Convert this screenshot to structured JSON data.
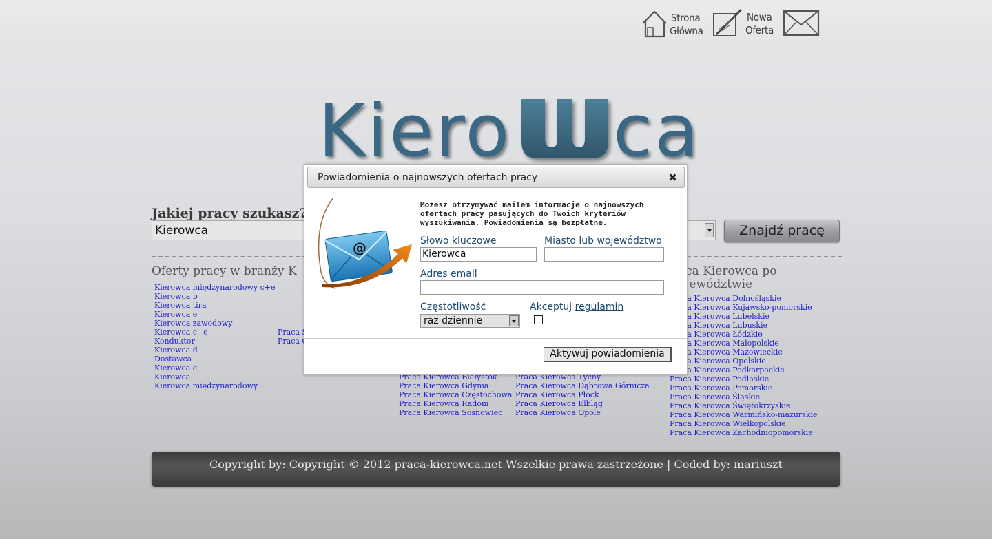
{
  "nav": {
    "home_line1": "Strona",
    "home_line2": "Główna",
    "new_offer_line1": "Nowa",
    "new_offer_line2": "Oferta"
  },
  "logo": {
    "text_left": "Kiero",
    "text_right": "ca"
  },
  "search": {
    "label": "Jakiej pracy szukasz?",
    "keyword_value": "Kierowca",
    "button_label": "Znajdź pracę"
  },
  "sections": {
    "industry_title": "Oferty pracy w branży K",
    "region_title_line1": "aca Kierowca po",
    "region_title_line2": "ojewództwie"
  },
  "industry_links": [
    "Kierowca międzynarodowy c+e",
    "Kierowca b",
    "Kierowca tira",
    "Kierowca e",
    "Kierowca zawodowy",
    "Kierowca c+e",
    "Konduktor",
    "Kierowca d",
    "Dostawca",
    "Kierowca c",
    "Kierowca",
    "Kierowca międzynarodowy"
  ],
  "middle_links": [
    "Praca S",
    "Praca C"
  ],
  "city_links_1": [
    "Praca Kierowca Białystok",
    "Praca Kierowca Gdynia",
    "Praca Kierowca Częstochowa",
    "Praca Kierowca Radom",
    "Praca Kierowca Sosnowiec"
  ],
  "city_links_2": [
    "Praca Kierowca Tychy",
    "Praca Kierowca Dąbrowa Górnicza",
    "Praca Kierowca Płock",
    "Praca Kierowca Elbląg",
    "Praca Kierowca Opole"
  ],
  "region_links": [
    "Praca Kierowca Dolnośląskie",
    "Praca Kierowca Kujawsko-pomorskie",
    "Praca Kierowca Lubelskie",
    "Praca Kierowca Lubuskie",
    "Praca Kierowca Łódzkie",
    "Praca Kierowca Małopolskie",
    "Praca Kierowca Mazowieckie",
    "Praca Kierowca Opolskie",
    "Praca Kierowca Podkarpackie",
    "Praca Kierowca Podlaskie",
    "Praca Kierowca Pomorskie",
    "Praca Kierowca Śląskie",
    "Praca Kierowca Świętokrzyskie",
    "Praca Kierowca Warmińsko-mazurskie",
    "Praca Kierowca Wielkopolskie",
    "Praca Kierowca Zachodniopomorskie"
  ],
  "footer": {
    "text": "Copyright by: Copyright © 2012 praca-kierowca.net Wszelkie prawa zastrzeżone | Coded by: mariuszt"
  },
  "modal": {
    "title": "Powiadomienia o najnowszych ofertach pracy",
    "close_glyph": "✖",
    "intro": "Możesz otrzymywać mailem informacje o najnowszych ofertach pracy pasujących do Twoich kryteriów wyszukiwania. Powiadomienia są bezpłatne.",
    "keyword_label": "Słowo kluczowe",
    "keyword_value": "Kierowca",
    "city_label": "Miasto lub województwo",
    "city_value": "",
    "email_label": "Adres email",
    "email_value": "",
    "frequency_label": "Częstotliwość",
    "frequency_value": "raz dziennie",
    "accept_label": "Akceptuj ",
    "accept_link": "regulamin",
    "activate_button": "Aktywuj powiadomienia"
  },
  "colors": {
    "link": "#2222cc",
    "logo": "#3a6784",
    "label": "#1e4a70"
  }
}
